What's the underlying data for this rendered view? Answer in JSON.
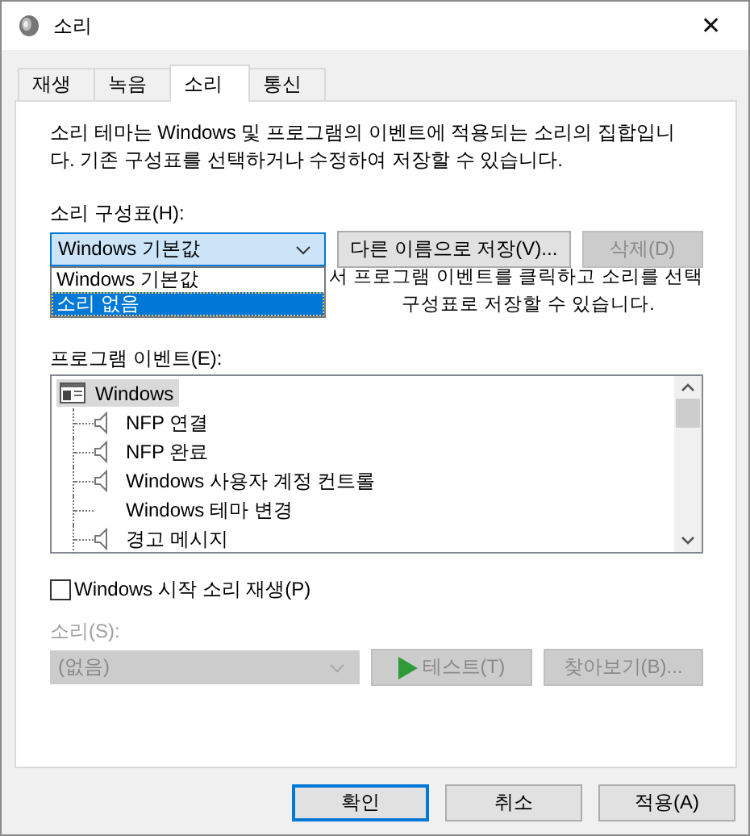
{
  "window": {
    "title": "소리",
    "close": "✕"
  },
  "tabs": [
    {
      "label": "재생",
      "selected": false
    },
    {
      "label": "녹음",
      "selected": false
    },
    {
      "label": "소리",
      "selected": true
    },
    {
      "label": "통신",
      "selected": false
    }
  ],
  "description": "소리 테마는 Windows 및 프로그램의 이벤트에 적용되는 소리의 집합입니다. 기존 구성표를 선택하거나 수정하여 저장할 수 있습니다.",
  "scheme": {
    "label": "소리 구성표(H):",
    "value": "Windows 기본값",
    "save_button": {
      "label": "다른 이름으로 저장(V)...",
      "disabled": false
    },
    "delete_button": {
      "label": "삭제(D)",
      "disabled": true
    },
    "options": [
      {
        "label": "Windows 기본값",
        "highlighted": false
      },
      {
        "label": "소리 없음",
        "highlighted": true
      }
    ]
  },
  "hint_lines": [
    "서 프로그램 이벤트를 클릭하고 소리를 선택",
    "구성표로 저장할 수 있습니다."
  ],
  "events": {
    "label": "프로그램 이벤트(E):",
    "root": {
      "label": "Windows",
      "selected": true,
      "children": [
        {
          "label": "NFP 연결",
          "has_sound": true
        },
        {
          "label": "NFP 완료",
          "has_sound": true
        },
        {
          "label": "Windows 사용자 계정 컨트롤",
          "has_sound": true
        },
        {
          "label": "Windows 테마 변경",
          "has_sound": false
        },
        {
          "label": "경고 메시지",
          "has_sound": true
        }
      ]
    }
  },
  "startup_sound": {
    "label": "Windows 시작 소리 재생(P)",
    "checked": false
  },
  "sound": {
    "label": "소리(S):",
    "value": "(없음)",
    "disabled": true,
    "test_button": "테스트(T)",
    "browse_button": "찾아보기(B)..."
  },
  "buttons": [
    {
      "label": "확인",
      "default": true
    },
    {
      "label": "취소",
      "default": false
    },
    {
      "label": "적용(A)",
      "default": false
    }
  ]
}
